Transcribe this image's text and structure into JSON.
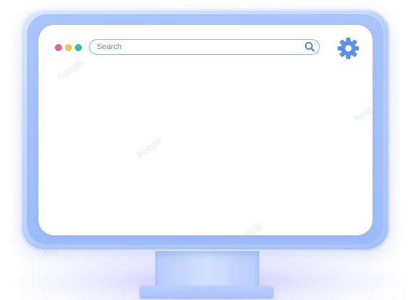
{
  "window_controls": [
    {
      "name": "close",
      "color": "#e8609a"
    },
    {
      "name": "minimize",
      "color": "#f2c94c"
    },
    {
      "name": "maximize",
      "color": "#2ec4a0"
    }
  ],
  "search": {
    "placeholder": "Search",
    "value": "",
    "icon": "search-icon",
    "icon_color": "#5b84d6"
  },
  "settings": {
    "icon": "gear-icon",
    "color": "#5b8fe8"
  },
  "watermark": {
    "text": "freepik"
  },
  "colors": {
    "frame": "#c2d6ff",
    "bezel": "#a9c4fb",
    "screen": "#ffffff",
    "accent": "#8fb0f0"
  }
}
